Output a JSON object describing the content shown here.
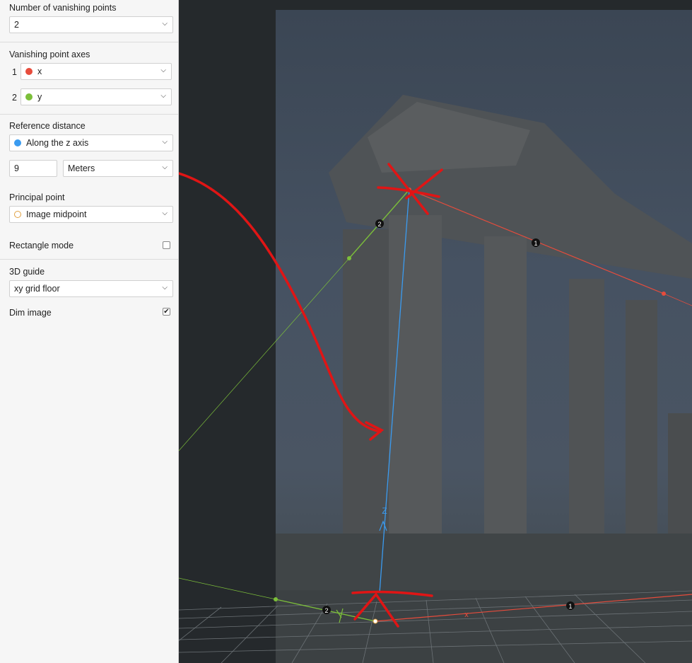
{
  "panel": {
    "num_vp_label": "Number of vanishing points",
    "num_vp_value": "2",
    "vp_axes_label": "Vanishing point axes",
    "vp_axes": [
      {
        "index": "1",
        "value": "x",
        "color": "#e74c3c"
      },
      {
        "index": "2",
        "value": "y",
        "color": "#7cbf3a"
      }
    ],
    "ref_distance_label": "Reference distance",
    "ref_axis_value": "Along the z axis",
    "ref_axis_color": "#3a9bf0",
    "ref_length_value": "9",
    "ref_unit_value": "Meters",
    "principal_point_label": "Principal point",
    "principal_point_value": "Image midpoint",
    "principal_point_color": "#e0a040",
    "rect_mode_label": "Rectangle mode",
    "rect_mode_checked": false,
    "guide_label": "3D guide",
    "guide_value": "xy grid floor",
    "dim_label": "Dim image",
    "dim_checked": true
  },
  "viewport": {
    "marker_1_top": "1",
    "marker_2_top": "2",
    "marker_1_bottom": "1",
    "marker_2_bottom": "2",
    "z_axis_label": "Z",
    "x_axis_label": "x",
    "colors": {
      "x_axis": "#e74c3c",
      "y_axis": "#7cbf3a",
      "z_axis": "#3a9bf0",
      "annotation": "#e01515"
    }
  }
}
